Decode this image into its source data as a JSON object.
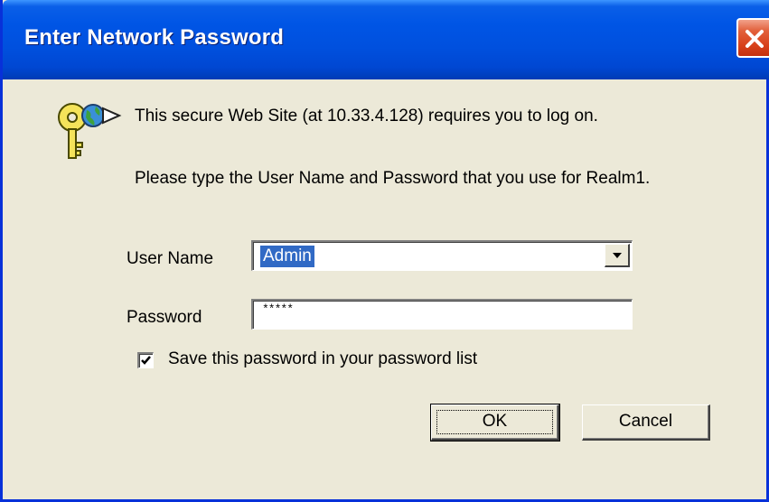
{
  "window": {
    "title": "Enter Network Password"
  },
  "message": {
    "line1": "This secure Web Site (at 10.33.4.128) requires you to log on.",
    "line2": "Please type the User Name and Password that you use for Realm1."
  },
  "form": {
    "username_label": "User Name",
    "username_value": "Admin",
    "password_label": "Password",
    "password_value": "*****",
    "save_label": "Save this password in your password list",
    "save_checked": true
  },
  "buttons": {
    "ok_label": "OK",
    "cancel_label": "Cancel"
  },
  "icons": {
    "titlebar_close": "close-icon",
    "dialog": "key-globe-icon",
    "dropdown": "chevron-down-icon",
    "checkbox": "checkmark-icon"
  },
  "colors": {
    "titlebar": "#0055e5",
    "close_button": "#d8421b",
    "dialog_background": "#ece9d8",
    "selection": "#316ac5"
  }
}
